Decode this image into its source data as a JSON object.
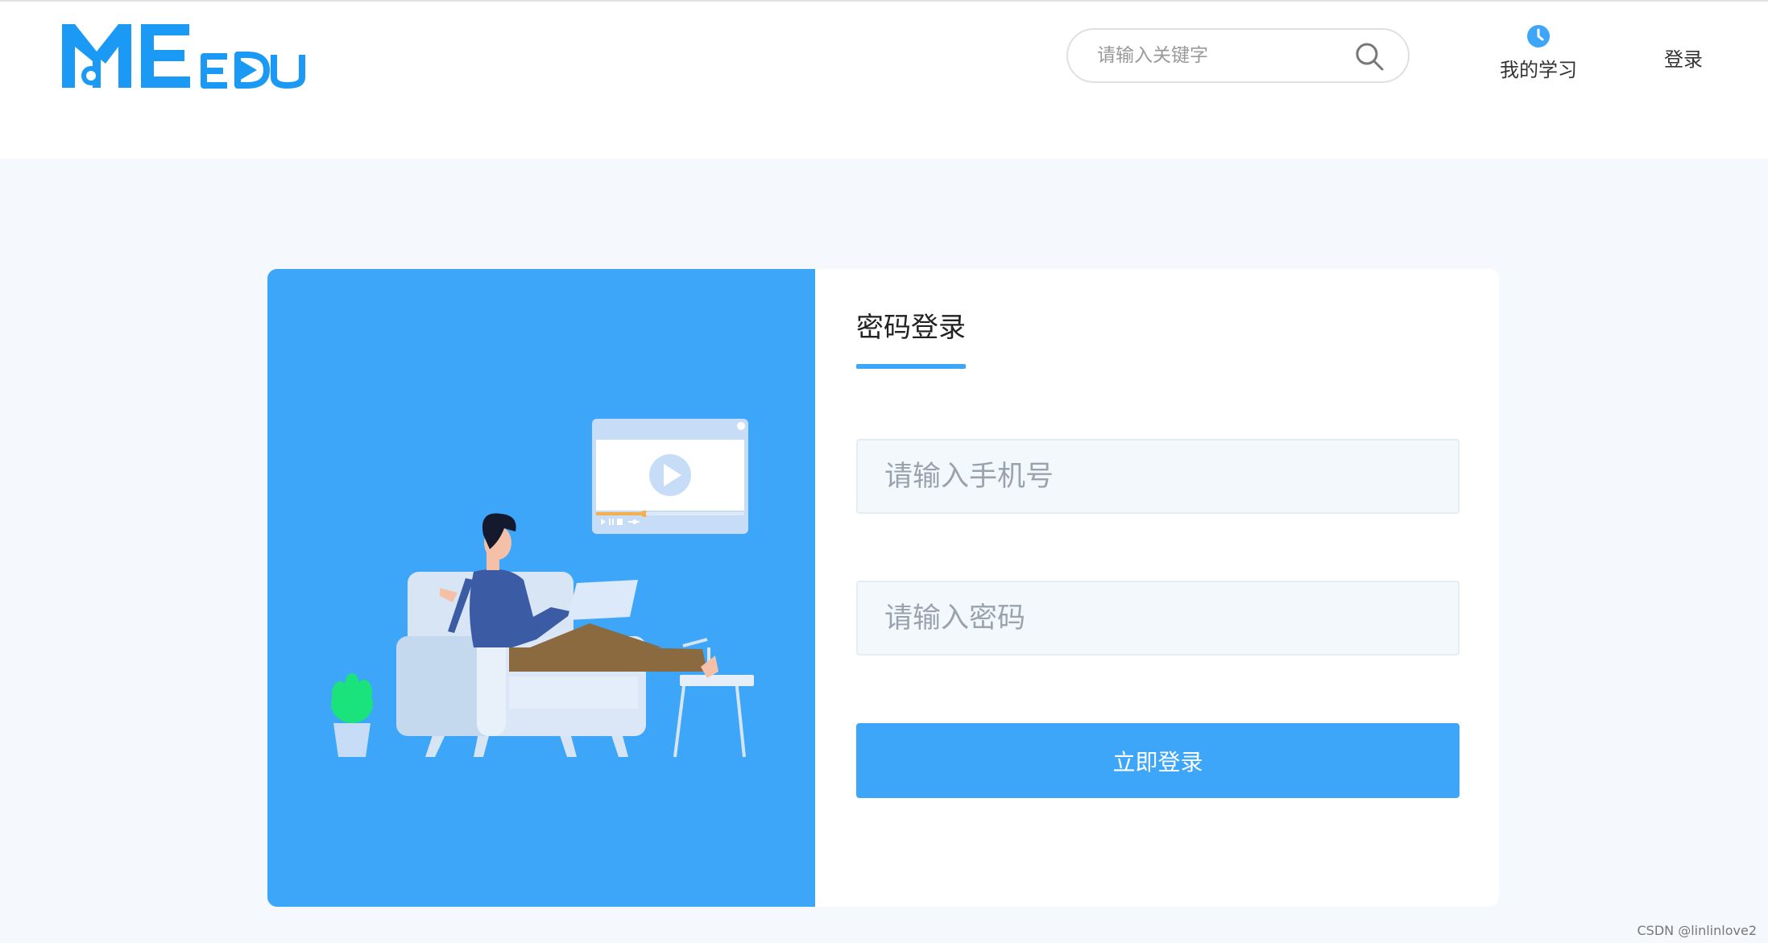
{
  "header": {
    "search": {
      "placeholder": "请输入关键字"
    },
    "my_study_label": "我的学习",
    "login_label": "登录"
  },
  "login": {
    "tab_title": "密码登录",
    "phone_placeholder": "请输入手机号",
    "password_placeholder": "请输入密码",
    "submit_label": "立即登录"
  },
  "watermark": "CSDN @linlinlove2",
  "colors": {
    "brand": "#1a9af4",
    "accent": "#3ea6f9",
    "page_bg": "#f5f9fd",
    "input_bg": "#f3f8fd"
  },
  "icons": {
    "logo": "meedu-logo",
    "search": "search-icon",
    "my_study": "clock-icon"
  }
}
